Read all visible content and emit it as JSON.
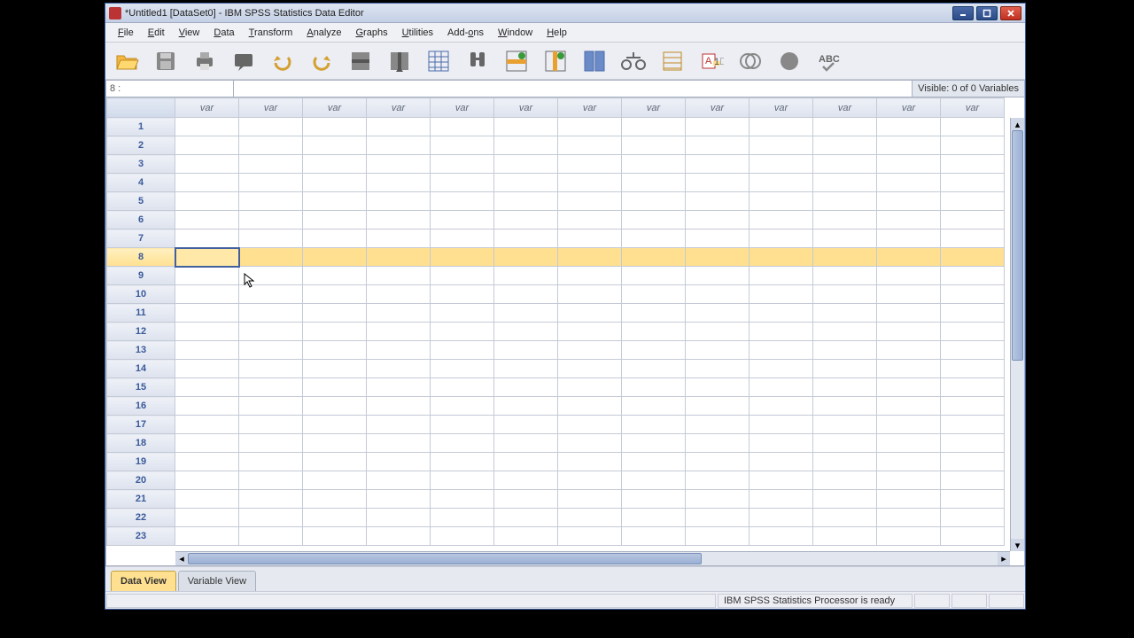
{
  "titlebar": {
    "text": "*Untitled1 [DataSet0] - IBM SPSS Statistics Data Editor"
  },
  "menu": {
    "file": "File",
    "edit": "Edit",
    "view": "View",
    "data": "Data",
    "transform": "Transform",
    "analyze": "Analyze",
    "graphs": "Graphs",
    "utilities": "Utilities",
    "addons": "Add-ons",
    "window": "Window",
    "help": "Help"
  },
  "toolbar_icons": {
    "open": "open-file-icon",
    "save": "save-icon",
    "print": "print-icon",
    "recall": "recall-dialog-icon",
    "undo": "undo-icon",
    "redo": "redo-icon",
    "goto_case": "goto-case-icon",
    "goto_var": "goto-variable-icon",
    "variables": "variables-icon",
    "find": "find-icon",
    "insert_case": "insert-case-icon",
    "insert_var": "insert-variable-icon",
    "split": "split-file-icon",
    "weight": "weight-cases-icon",
    "select": "select-cases-icon",
    "labels": "value-labels-icon",
    "sets": "use-sets-icon",
    "show_all": "show-all-icon",
    "spell": "spell-check-icon"
  },
  "info": {
    "name": "8 :",
    "value": "",
    "visible": "Visible: 0 of 0 Variables"
  },
  "grid": {
    "col_label": "var",
    "columns": 13,
    "rows": 23,
    "selected_row": 8,
    "active_col": 1
  },
  "tabs": {
    "data_view": "Data View",
    "variable_view": "Variable View",
    "active": "data_view"
  },
  "status": {
    "processor": "IBM SPSS Statistics Processor is ready"
  }
}
